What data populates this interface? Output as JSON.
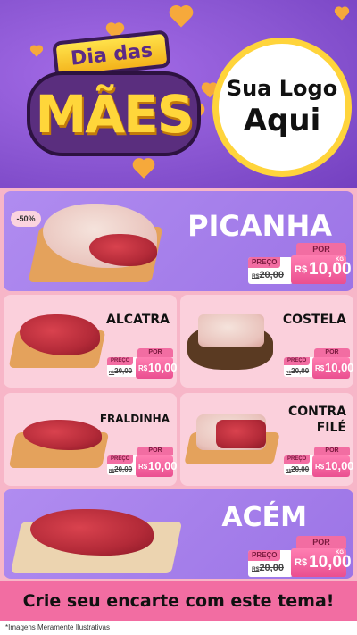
{
  "header": {
    "title_top": "Dia das",
    "title_main": "MÃES",
    "logo_line1": "Sua Logo",
    "logo_line2": "Aqui"
  },
  "colors": {
    "accent": "#f26da2",
    "gold": "#ffd43b",
    "purple": "#8e5cd6"
  },
  "products": [
    {
      "name": "PICANHA",
      "discount": "-50%",
      "preco_label": "PREÇO",
      "old_prefix": "R$",
      "old": "20,00",
      "por": "POR",
      "rs": "R$",
      "price": "10,00",
      "unit": "KG"
    },
    {
      "name": "ALCATRA",
      "preco_label": "PREÇO",
      "old_prefix": "R$",
      "old": "20,00",
      "por": "POR",
      "rs": "R$",
      "price": "10,00"
    },
    {
      "name": "COSTELA",
      "preco_label": "PREÇO",
      "old_prefix": "R$",
      "old": "20,00",
      "por": "POR",
      "rs": "R$",
      "price": "10,00"
    },
    {
      "name": "FRALDINHA",
      "preco_label": "PREÇO",
      "old_prefix": "R$",
      "old": "20,00",
      "por": "POR",
      "rs": "R$",
      "price": "10,00"
    },
    {
      "name_line1": "CONTRA",
      "name_line2": "FILÉ",
      "preco_label": "PREÇO",
      "old_prefix": "R$",
      "old": "20,00",
      "por": "POR",
      "rs": "R$",
      "price": "10,00"
    },
    {
      "name": "ACÉM",
      "preco_label": "PREÇO",
      "old_prefix": "R$",
      "old": "20,00",
      "por": "POR",
      "rs": "R$",
      "price": "10,00",
      "unit": "KG"
    }
  ],
  "cta": "Crie seu encarte com este tema!",
  "footnote": "*Imagens Meramente Ilustrativas"
}
